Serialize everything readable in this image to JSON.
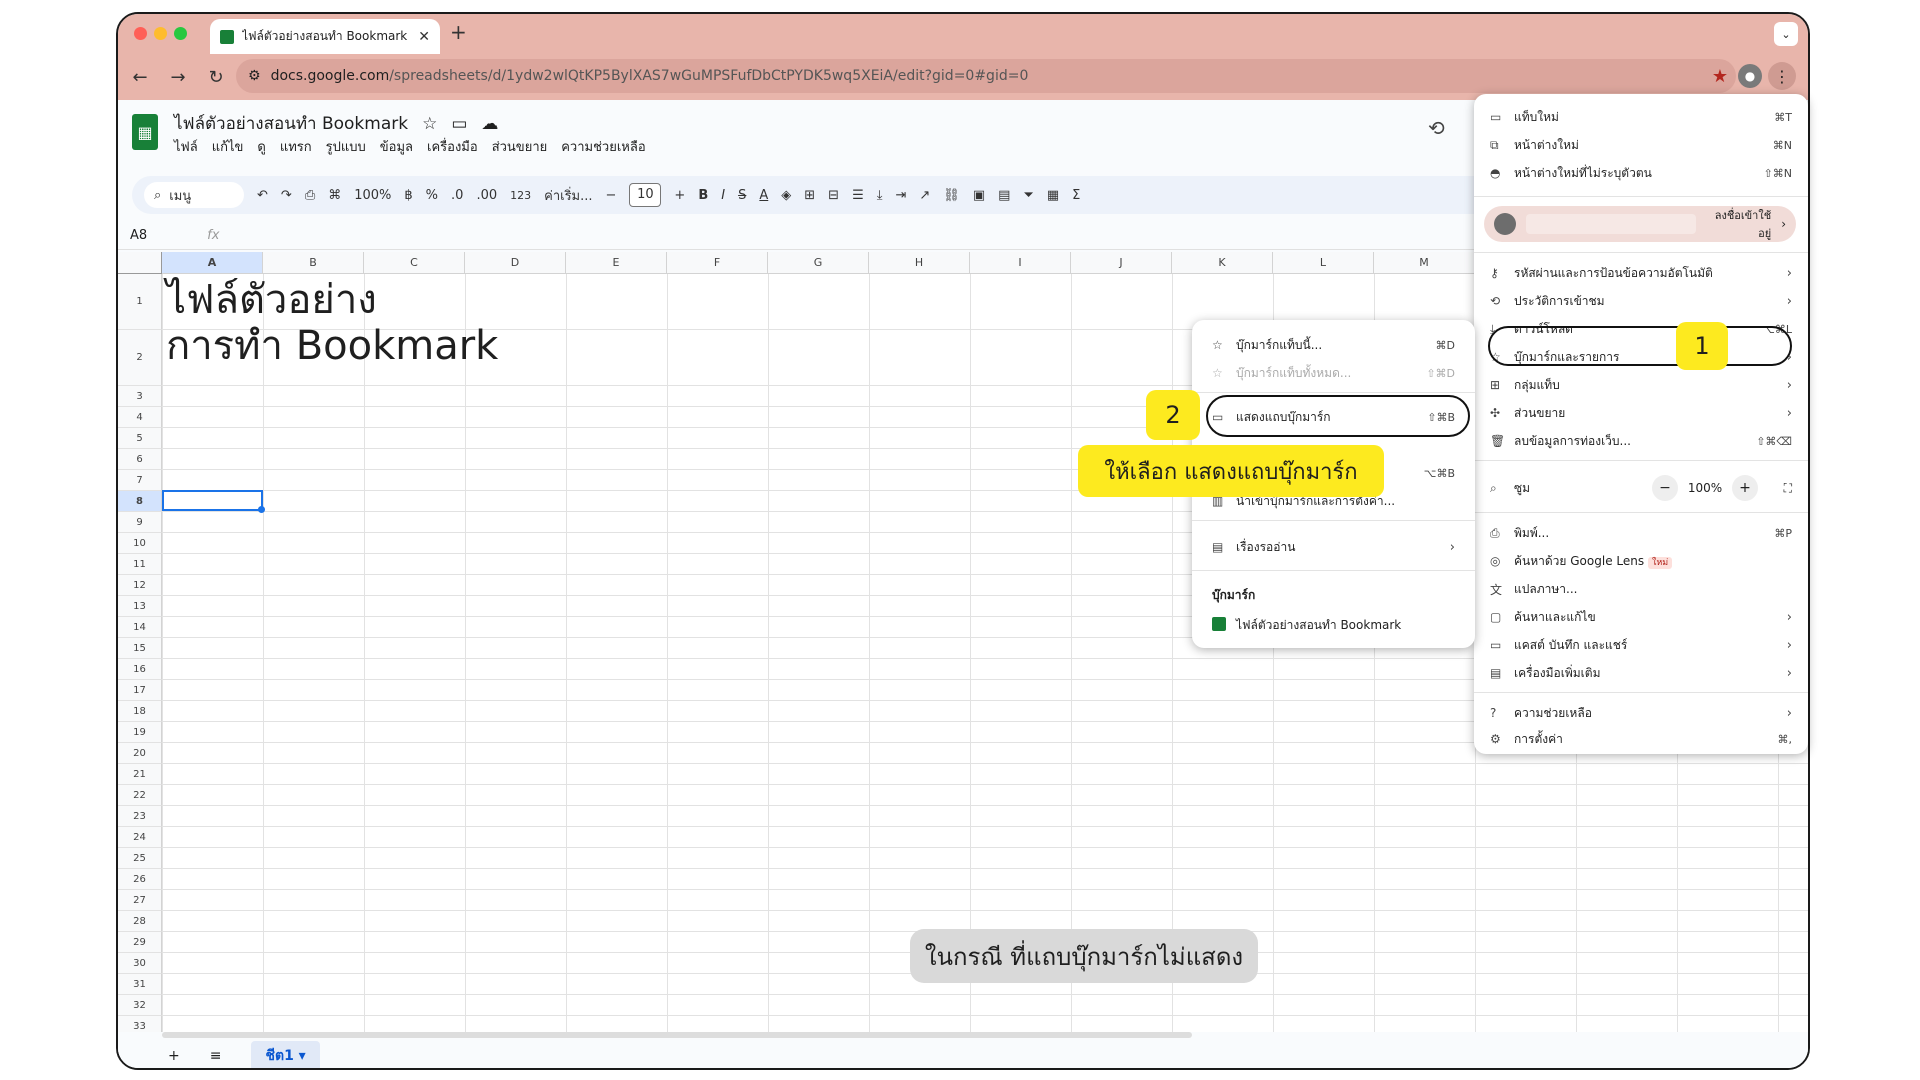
{
  "browser": {
    "tab_title": "ไฟล์ตัวอย่างสอนทำ Bookmark -",
    "tab_close": "✕",
    "new_tab": "+",
    "expand": "⌄",
    "url_host": "docs.google.com",
    "url_path": "/spreadsheets/d/1ydw2wlQtKP5BylXAS7wGuMPSFufDbCtPYDK5wq5XEiA/edit?gid=0#gid=0",
    "back": "←",
    "forward": "→",
    "reload": "↻",
    "site_info": "⚙",
    "bookmark_star": "★",
    "kebab": "⋮",
    "colors": {
      "titlebar": "#e8b5ab",
      "accent": "#0b57d0",
      "highlight": "#fdea1f"
    }
  },
  "sheets": {
    "doc_title": "ไฟล์ตัวอย่างสอนทำ Bookmark",
    "menu": [
      "ไฟล์",
      "แก้ไข",
      "ดู",
      "แทรก",
      "รูปแบบ",
      "ข้อมูล",
      "เครื่องมือ",
      "ส่วนขยาย",
      "ความช่วยเหลือ"
    ],
    "toolbar": {
      "search": "เมนู",
      "zoom": "100%",
      "currency": "฿",
      "percent": "%",
      "dec_dec": ".0",
      "dec_inc": ".00",
      "number_fmt": "123",
      "font": "ค่าเริ่ม...",
      "font_size": "10",
      "minus": "−",
      "plus": "+",
      "bold": "B",
      "italic": "I",
      "strike": "S",
      "textcolor": "A",
      "sum": "Σ"
    },
    "cell_ref": "A8",
    "fx": "fx",
    "columns": [
      "A",
      "B",
      "C",
      "D",
      "E",
      "F",
      "G",
      "H",
      "I",
      "J",
      "K",
      "L",
      "M"
    ],
    "rows": [
      "1",
      "2",
      "3",
      "4",
      "5",
      "6",
      "7",
      "8",
      "9",
      "10",
      "11",
      "12",
      "13",
      "14",
      "15",
      "16",
      "17",
      "18",
      "19",
      "20",
      "21",
      "22",
      "23",
      "24",
      "25",
      "26",
      "27",
      "28",
      "29",
      "30",
      "31",
      "32",
      "33"
    ],
    "cell_a1": "ไฟล์ตัวอย่าง",
    "cell_a2": "การทำ Bookmark",
    "sheet_tab": "ชีต1",
    "add_sheet": "+",
    "all_sheets": "≡"
  },
  "chrome_menu": {
    "new_tab": {
      "label": "แท็บใหม่",
      "shortcut": "⌘T"
    },
    "new_window": {
      "label": "หน้าต่างใหม่",
      "shortcut": "⌘N"
    },
    "incognito": {
      "label": "หน้าต่างใหม่ที่ไม่ระบุตัวตน",
      "shortcut": "⇧⌘N"
    },
    "signed_in": "ลงชื่อเข้าใช้อยู่",
    "passwords": "รหัสผ่านและการป้อนข้อความอัตโนมัติ",
    "history": "ประวัติการเข้าชม",
    "downloads": {
      "label": "ดาวน์โหลด",
      "shortcut": "⌥⌘L"
    },
    "bookmarks": "บุ๊กมาร์กและรายการ",
    "tab_groups": "กลุ่มแท็บ",
    "extensions": "ส่วนขยาย",
    "clear_data": {
      "label": "ลบข้อมูลการท่องเว็บ...",
      "shortcut": "⇧⌘⌫"
    },
    "zoom": {
      "label": "ซูม",
      "minus": "−",
      "value": "100%",
      "plus": "+",
      "fullscreen": "⛶"
    },
    "print": {
      "label": "พิมพ์...",
      "shortcut": "⌘P"
    },
    "lens": {
      "label": "ค้นหาด้วย Google Lens",
      "badge": "ใหม่"
    },
    "translate": "แปลภาษา...",
    "find_edit": "ค้นหาและแก้ไข",
    "cast": "แคสต์ บันทึก และแชร์",
    "more_tools": "เครื่องมือเพิ่มเติม",
    "help": "ความช่วยเหลือ",
    "settings": {
      "label": "การตั้งค่า",
      "shortcut": "⌘,"
    }
  },
  "bookmarks_menu": {
    "bookmark_tab": {
      "label": "บุ๊กมาร์กแท็บนี้...",
      "shortcut": "⌘D"
    },
    "bookmark_all": {
      "label": "บุ๊กมาร์กแท็บทั้งหมด...",
      "shortcut": "⇧⌘D"
    },
    "show_bar": {
      "label": "แสดงแถบบุ๊กมาร์ก",
      "shortcut": "⇧⌘B"
    },
    "manager_shortcut": "⌥⌘B",
    "import": "นำเข้าบุ๊กมาร์กและการตั้งค่า...",
    "reading_list": "เรื่องรออ่าน",
    "section_title": "บุ๊กมาร์ก",
    "item": "ไฟล์ตัวอย่างสอนทำ Bookmark"
  },
  "annotations": {
    "step1": "1",
    "step2": "2",
    "instruction": "ให้เลือก แสดงแถบบุ๊กมาร์ก",
    "caption": "ในกรณี ที่แถบบุ๊กมาร์กไม่แสดง"
  }
}
